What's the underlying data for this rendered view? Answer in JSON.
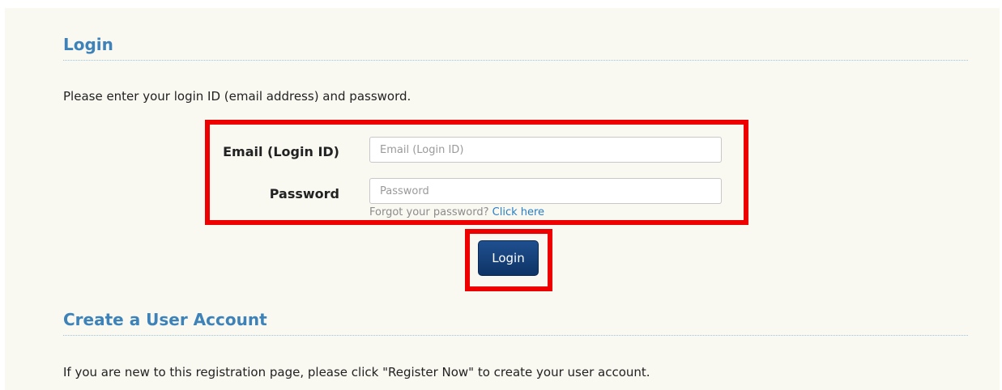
{
  "login_section": {
    "title": "Login",
    "intro": "Please enter your login ID (email address) and password."
  },
  "form": {
    "email_label": "Email (Login ID)",
    "email_placeholder": "Email (Login ID)",
    "email_value": "",
    "password_label": "Password",
    "password_placeholder": "Password",
    "password_value": "",
    "forgot_text": "Forgot your password?",
    "forgot_link": "Click here",
    "login_button": "Login"
  },
  "create_section": {
    "title": "Create a User Account",
    "text": "If you are new to this registration page, please click \"Register Now\" to create your user account."
  },
  "colors": {
    "page_background": "#f9f8f1",
    "heading": "#3d82b8",
    "highlight": "#ee0000",
    "button": "#14407a",
    "link": "#2a7ec2"
  }
}
